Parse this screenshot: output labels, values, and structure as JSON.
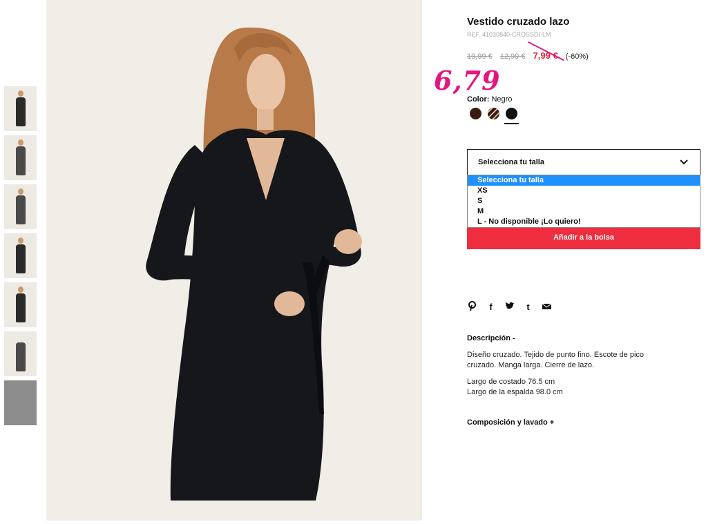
{
  "thumbnails": [
    {
      "label": "thumb-1"
    },
    {
      "label": "thumb-2"
    },
    {
      "label": "thumb-3"
    },
    {
      "label": "thumb-4"
    },
    {
      "label": "thumb-5"
    },
    {
      "label": "thumb-6"
    },
    {
      "label": "thumb-7"
    }
  ],
  "product": {
    "title": "Vestido cruzado lazo",
    "ref": "REF. 41030840-CROSSDI-LM",
    "price_old_1": "19,99 €",
    "price_old_2": "12,99 €",
    "price_now": "7,99 €",
    "discount": "(-60%)",
    "handwritten_price": "6,79",
    "color_label": "Color:",
    "color_value": "Negro"
  },
  "swatches": [
    {
      "name": "brown",
      "color": "#3b1c12"
    },
    {
      "name": "striped",
      "color": "#3b1c12"
    },
    {
      "name": "black",
      "color": "#111111",
      "selected": true
    }
  ],
  "size_select": {
    "value": "Selecciona tu talla",
    "options": [
      "Selecciona tu talla",
      "XS",
      "S",
      "M",
      "L - No disponible ¡Lo quiero!"
    ]
  },
  "add_to_bag": "Añadir a la bolsa",
  "share_icons": [
    "pinterest-icon",
    "facebook-icon",
    "twitter-icon",
    "tumblr-icon",
    "email-icon"
  ],
  "share_glyphs": {
    "pinterest": "𝓅",
    "facebook": "f",
    "twitter": "🐦",
    "tumblr": "t",
    "email": "✉"
  },
  "description": {
    "heading": "Descripción  -",
    "p1": "Diseño cruzado. Tejido de punto fino. Escote de pico cruzado. Manga larga. Cierre de lazo.",
    "p2": "Largo de costado 76.5 cm",
    "p3": "Largo de la espalda 98.0 cm"
  },
  "composition_heading": "Composición y lavado  +",
  "colors": {
    "accent_red": "#ee2d3f",
    "annotation_pink": "#e6147f",
    "highlight_blue": "#1e90ff"
  }
}
